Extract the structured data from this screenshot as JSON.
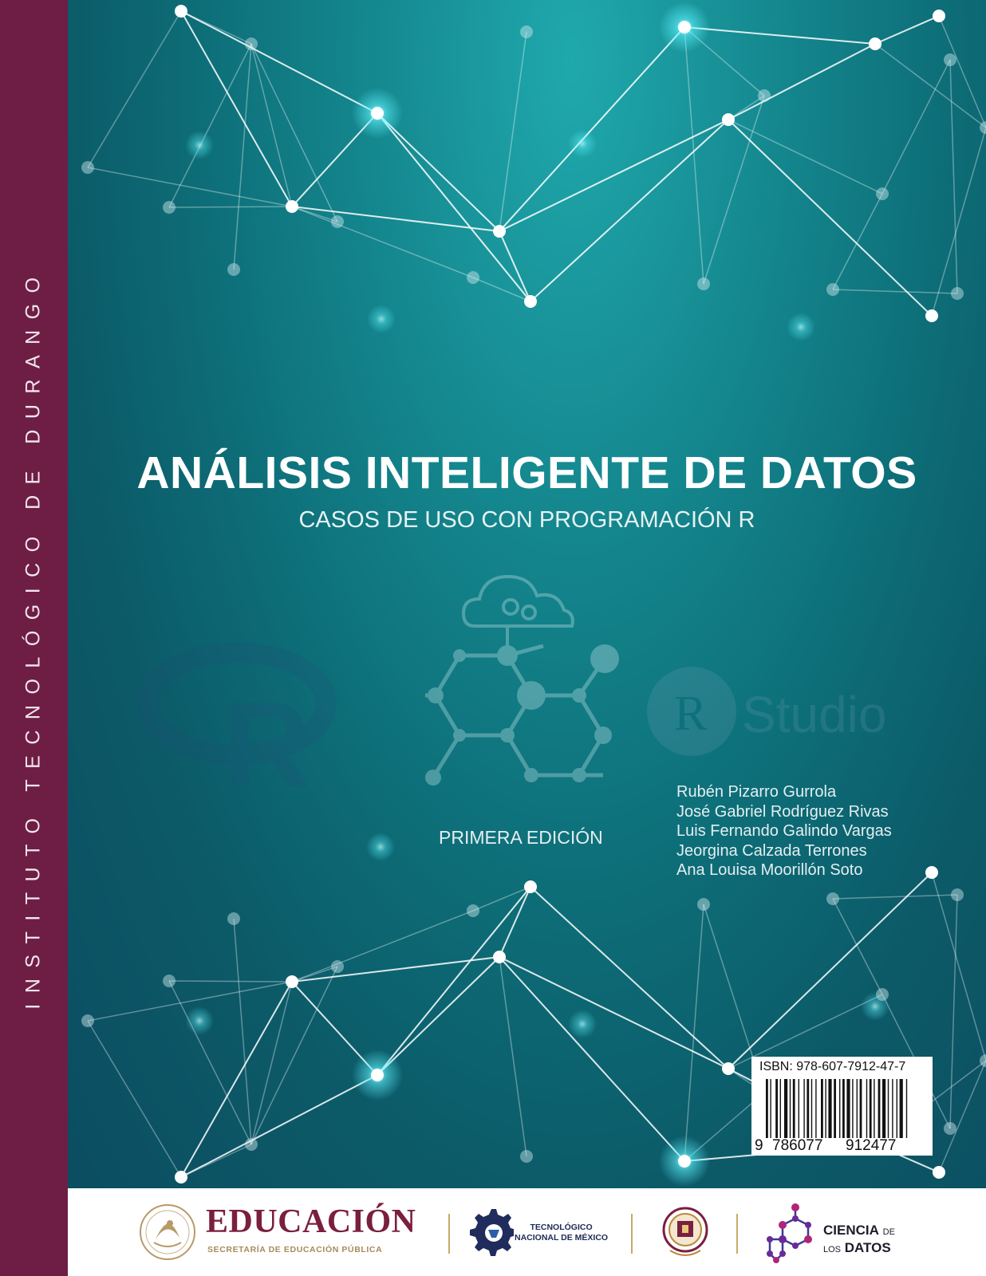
{
  "spine": {
    "text": "INSTITUTO TECNOLÓGICO DE DURANGO"
  },
  "cover": {
    "title": "ANÁLISIS INTELIGENTE DE DATOS",
    "subtitle": "CASOS DE USO CON PROGRAMACIÓN R",
    "edition": "PRIMERA EDICIÓN",
    "authors": [
      "Rubén Pizarro Gurrola",
      "José Gabriel Rodríguez Rivas",
      "Luis Fernando Galindo Vargas",
      "Jeorgina Calzada Terrones",
      "Ana Louisa Moorillón Soto"
    ],
    "icons": [
      "r-logo-icon",
      "cloud-gears-molecule-icon",
      "rstudio-logo-icon"
    ],
    "rstudio_text": "Studio",
    "r_letter": "R"
  },
  "isbn": {
    "label": "ISBN: 978-607-7912-47-7",
    "digits": [
      "9",
      "786077",
      "912477"
    ]
  },
  "footer": {
    "educacion": "EDUCACIÓN",
    "educacion_sub": "SECRETARÍA DE EDUCACIÓN PÚBLICA",
    "tecnologico_line1": "TECNOLÓGICO",
    "tecnologico_line2": "NACIONAL DE MÉXICO",
    "ciencia_line1": "CIENCIA",
    "ciencia_de": "DE",
    "ciencia_los": "LOS",
    "ciencia_datos": "DATOS",
    "logos": [
      "mexico-coat-of-arms-icon",
      "tecnm-gear-icon",
      "itd-shield-icon",
      "ciencia-datos-molecule-icon"
    ]
  },
  "colors": {
    "spine": "#6e1e44",
    "cover_teal": "#15888f",
    "cover_deep": "#0b4d61",
    "educacion": "#7a1f3d",
    "gold": "#c9a96a"
  }
}
